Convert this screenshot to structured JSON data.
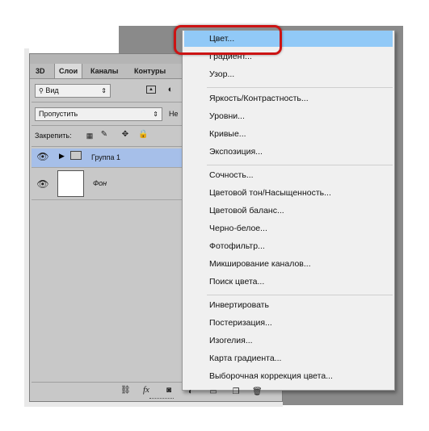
{
  "panel": {
    "tabs": [
      "3D",
      "Слои",
      "Каналы",
      "Контуры"
    ],
    "active_tab": "Слои",
    "filter_select": "Вид",
    "blend_select": "Пропустить",
    "opacity_label_partial": "Не",
    "lock_label": "Закрепить:",
    "layers": [
      {
        "name": "Группа 1",
        "type": "group",
        "selected": true
      },
      {
        "name": "Фон",
        "type": "background",
        "selected": false
      }
    ],
    "bottom_fx": "fx"
  },
  "menu": {
    "groups": [
      [
        "Цвет...",
        "Градиент...",
        "Узор..."
      ],
      [
        "Яркость/Контрастность...",
        "Уровни...",
        "Кривые...",
        "Экспозиция..."
      ],
      [
        "Сочность...",
        "Цветовой тон/Насыщенность...",
        "Цветовой баланс...",
        "Черно-белое...",
        "Фотофильтр...",
        "Микширование каналов...",
        "Поиск цвета..."
      ],
      [
        "Инвертировать",
        "Постеризация...",
        "Изогелия...",
        "Карта градиента...",
        "Выборочная коррекция цвета..."
      ]
    ],
    "highlighted": "Цвет...",
    "highlight_color": "#91c9f7",
    "callout_color": "#cc1414"
  }
}
